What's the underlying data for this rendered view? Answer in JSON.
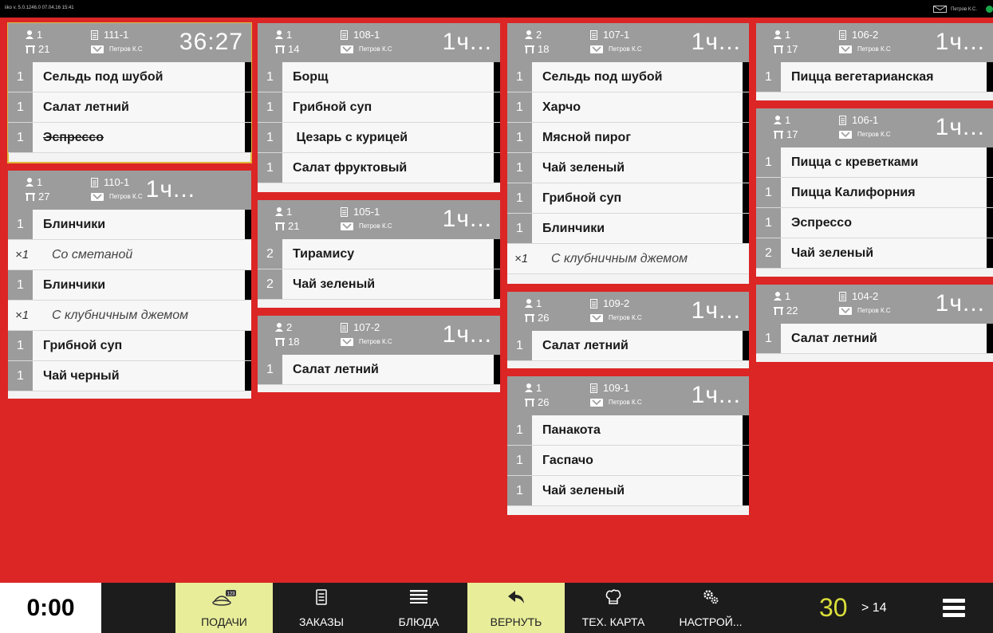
{
  "top_bar": {
    "version": "iiko v. 5.0.1246.0   07.04.16  15:41",
    "user": "Петров К.С."
  },
  "colors": {
    "background": "#dc2626",
    "header": "#9c9c9c",
    "highlight": "#e8ed9a",
    "counter": "#d9de3a",
    "selected_border": "#e0b83a"
  },
  "orders": [
    {
      "guests": "1",
      "table": "21",
      "order": "111-1",
      "waiter": "Петров К.С",
      "time": "36:27",
      "items": [
        {
          "qty": "1",
          "name": "Сельдь под шубой"
        },
        {
          "qty": "1",
          "name": "Салат летний"
        },
        {
          "qty": "1",
          "name": "Эспрессо"
        }
      ]
    },
    {
      "guests": "1",
      "table": "27",
      "order": "110-1",
      "waiter": "Петров К.С",
      "time": "1ч...",
      "items": [
        {
          "qty": "1",
          "name": "Блинчики"
        },
        {
          "qty": "×1",
          "name": "Со сметаной"
        },
        {
          "qty": "1",
          "name": "Блинчики"
        },
        {
          "qty": "×1",
          "name": "С клубничным джемом"
        },
        {
          "qty": "1",
          "name": "Грибной суп"
        },
        {
          "qty": "1",
          "name": "Чай черный"
        }
      ]
    },
    {
      "guests": "1",
      "table": "14",
      "order": "108-1",
      "waiter": "Петров К.С",
      "time": "1ч...",
      "items": [
        {
          "qty": "1",
          "name": "Борщ"
        },
        {
          "qty": "1",
          "name": "Грибной суп"
        },
        {
          "qty": "1",
          "name": " Цезарь с курицей"
        },
        {
          "qty": "1",
          "name": "Салат фруктовый"
        }
      ]
    },
    {
      "guests": "1",
      "table": "21",
      "order": "105-1",
      "waiter": "Петров К.С",
      "time": "1ч...",
      "items": [
        {
          "qty": "2",
          "name": "Тирамису"
        },
        {
          "qty": "2",
          "name": "Чай зеленый"
        }
      ]
    },
    {
      "guests": "2",
      "table": "18",
      "order": "107-2",
      "waiter": "Петров К.С",
      "time": "1ч...",
      "items": [
        {
          "qty": "1",
          "name": "Салат летний"
        }
      ]
    },
    {
      "guests": "2",
      "table": "18",
      "order": "107-1",
      "waiter": "Петров К.С",
      "time": "1ч...",
      "items": [
        {
          "qty": "1",
          "name": "Сельдь под шубой"
        },
        {
          "qty": "1",
          "name": "Харчо"
        },
        {
          "qty": "1",
          "name": "Мясной пирог"
        },
        {
          "qty": "1",
          "name": "Чай зеленый"
        },
        {
          "qty": "1",
          "name": "Грибной суп"
        },
        {
          "qty": "1",
          "name": "Блинчики"
        },
        {
          "qty": "×1",
          "name": "С клубничным джемом"
        }
      ]
    },
    {
      "guests": "1",
      "table": "26",
      "order": "109-2",
      "waiter": "Петров К.С",
      "time": "1ч...",
      "items": [
        {
          "qty": "1",
          "name": "Салат летний"
        }
      ]
    },
    {
      "guests": "1",
      "table": "26",
      "order": "109-1",
      "waiter": "Петров К.С",
      "time": "1ч...",
      "items": [
        {
          "qty": "1",
          "name": "Панакота"
        },
        {
          "qty": "1",
          "name": "Гаспачо"
        },
        {
          "qty": "1",
          "name": "Чай зеленый"
        }
      ]
    },
    {
      "guests": "1",
      "table": "17",
      "order": "106-2",
      "waiter": "Петров К.С",
      "time": "1ч...",
      "items": [
        {
          "qty": "1",
          "name": "Пицца вегетарианская"
        }
      ]
    },
    {
      "guests": "1",
      "table": "17",
      "order": "106-1",
      "waiter": "Петров К.С",
      "time": "1ч...",
      "items": [
        {
          "qty": "1",
          "name": "Пицца с креветками"
        },
        {
          "qty": "1",
          "name": "Пицца Калифорния"
        },
        {
          "qty": "1",
          "name": "Эспрессо"
        },
        {
          "qty": "2",
          "name": "Чай зеленый"
        }
      ]
    },
    {
      "guests": "1",
      "table": "22",
      "order": "104-2",
      "waiter": "Петров К.С",
      "time": "1ч...",
      "items": [
        {
          "qty": "1",
          "name": "Салат летний"
        }
      ]
    }
  ],
  "footer": {
    "timer": "0:00",
    "buttons": [
      "ПОДАЧИ",
      "ЗАКАЗЫ",
      "БЛЮДА",
      "ВЕРНУТЬ",
      "ТЕХ. КАРТА",
      "НАСТРОЙ..."
    ],
    "count": "30",
    "next": "> 14"
  }
}
